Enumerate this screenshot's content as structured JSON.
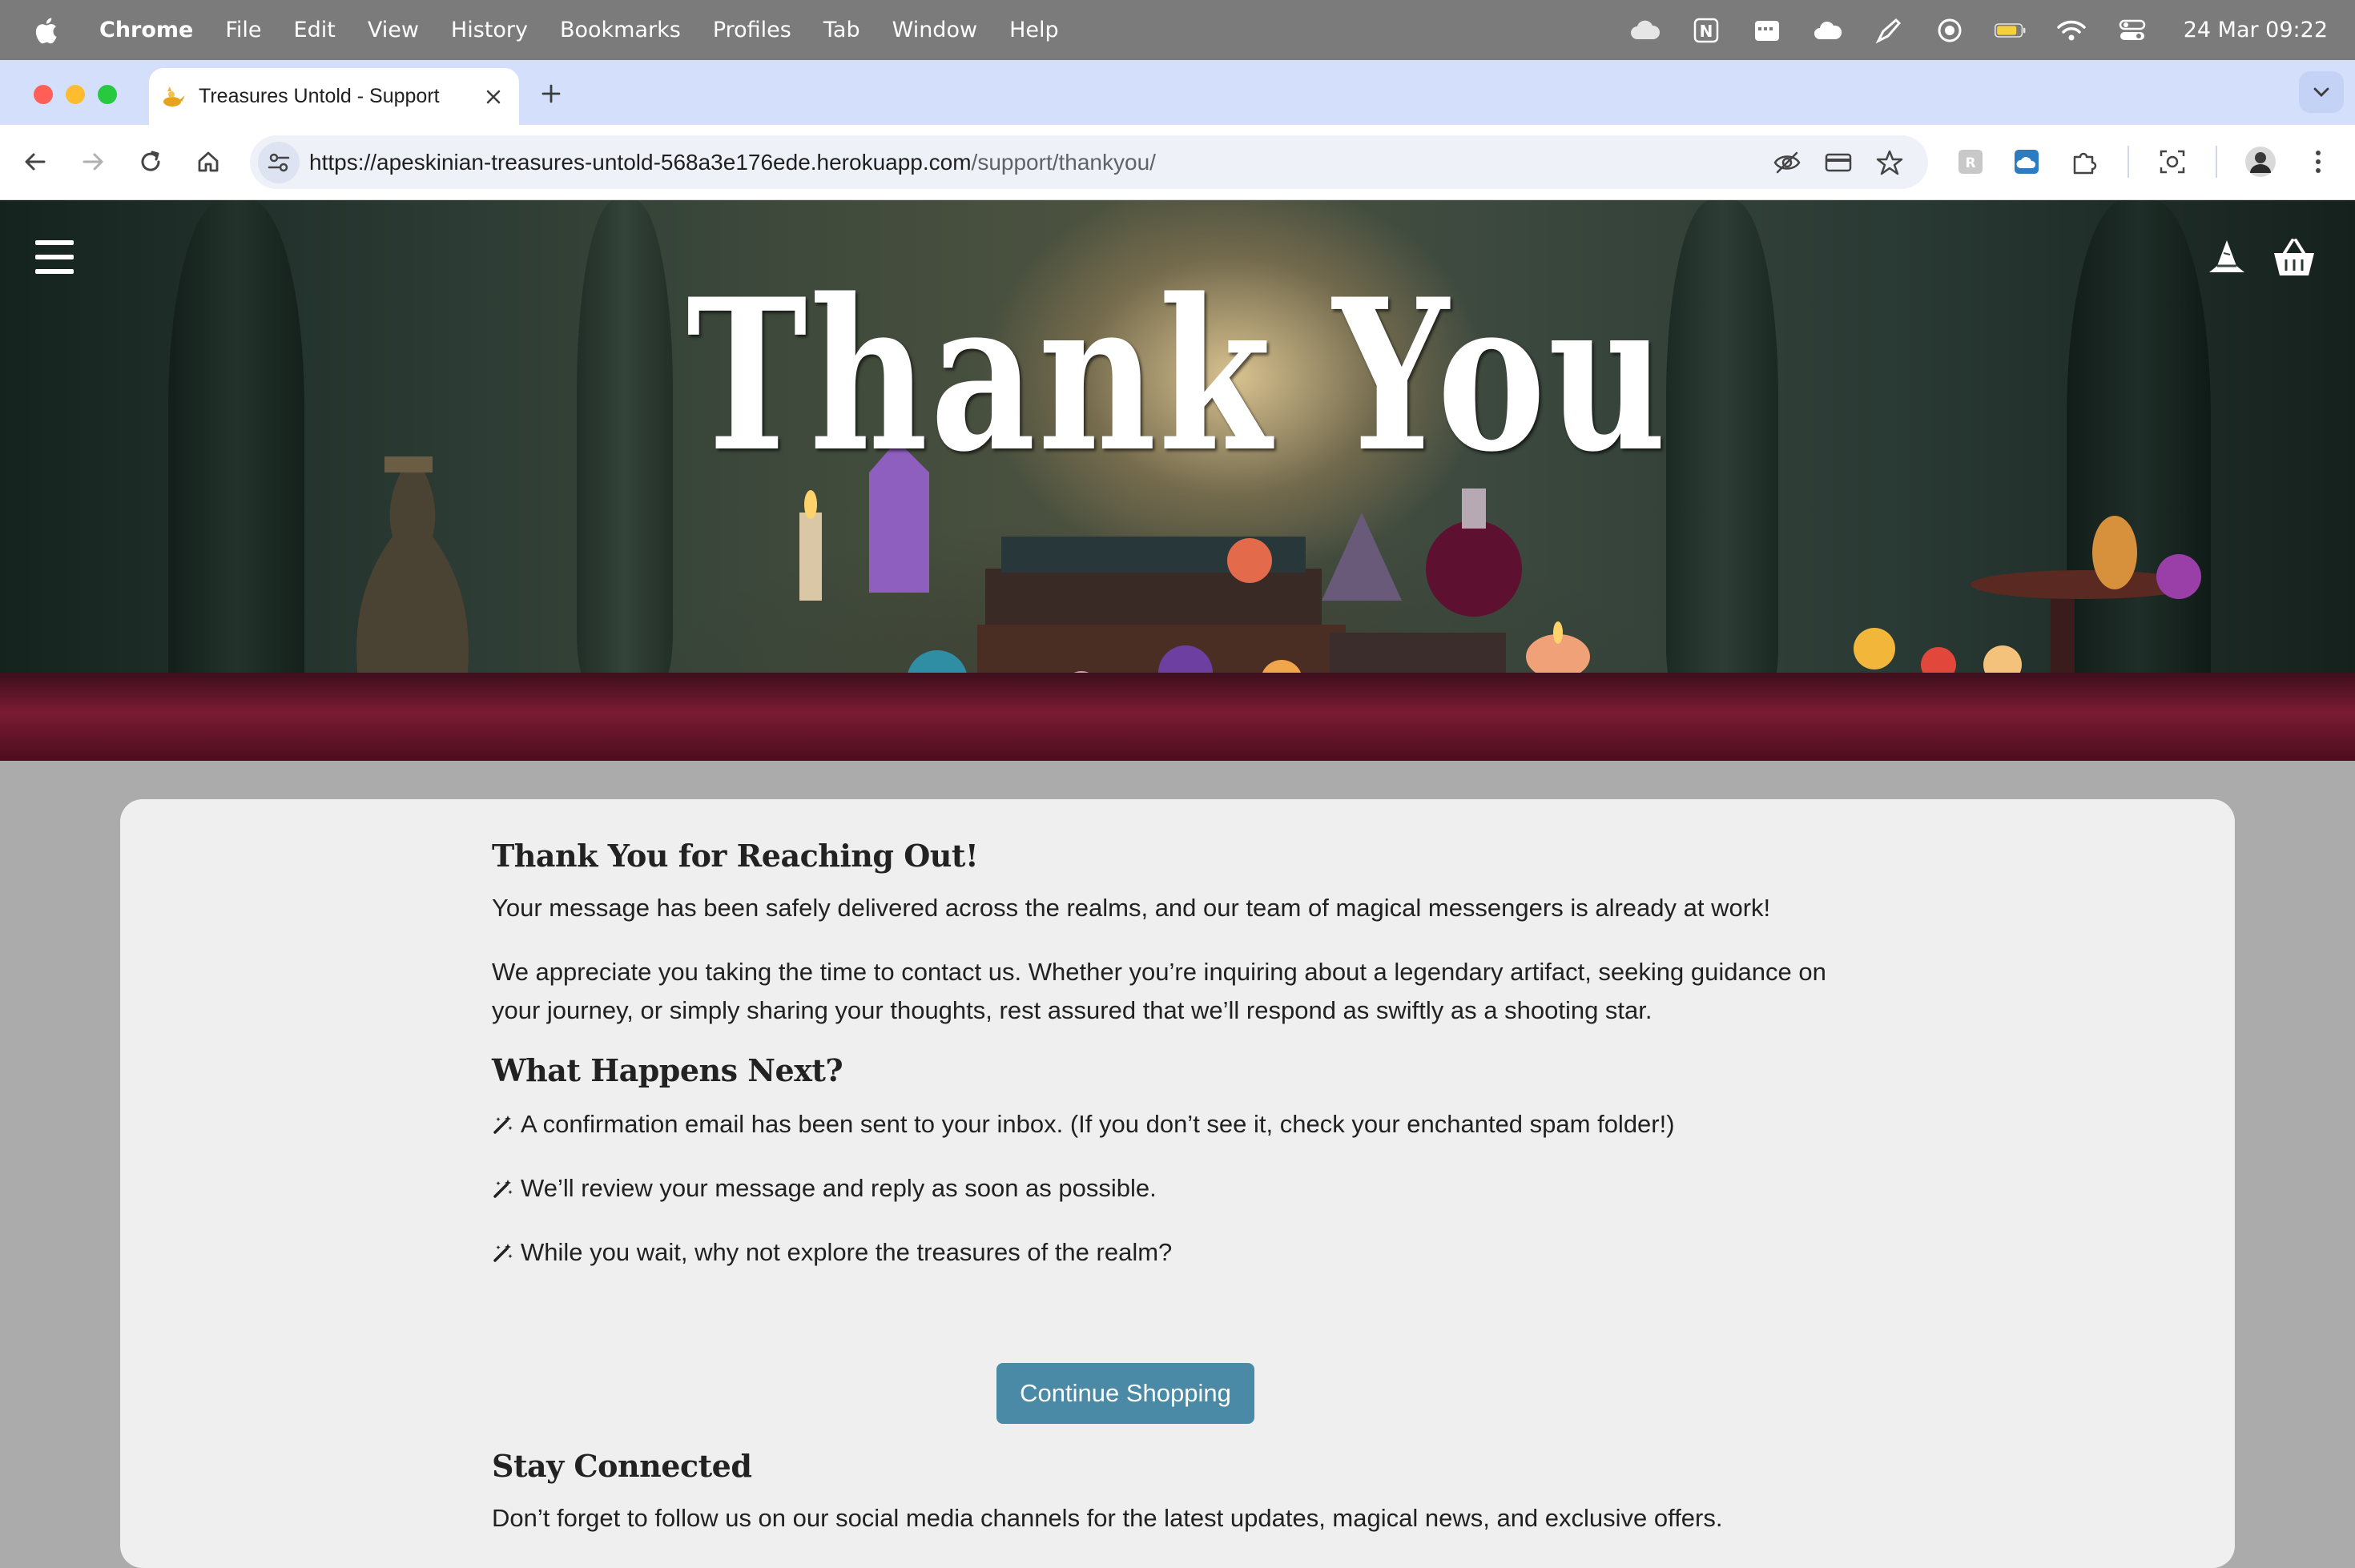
{
  "menubar": {
    "app_name": "Chrome",
    "items": [
      "File",
      "Edit",
      "View",
      "History",
      "Bookmarks",
      "Profiles",
      "Tab",
      "Window",
      "Help"
    ],
    "clock": "24 Mar  09:22",
    "status_icons": [
      "creative-cloud-icon",
      "notion-icon",
      "calendar-icon",
      "cloud-icon",
      "pencil-tool-icon",
      "circle-record-icon",
      "battery-icon",
      "wifi-icon",
      "control-center-icon"
    ]
  },
  "browser": {
    "tab_title": "Treasures Untold - Support",
    "url_host": "https://apeskinian-treasures-untold-568a3e176ede.herokuapp.com",
    "url_path": "/support/thankyou/"
  },
  "hero": {
    "title": "Thank You"
  },
  "main": {
    "heading_thanks": "Thank You for Reaching Out!",
    "para_delivered": "Your message has been safely delivered across the realms, and our team of magical messengers is already at work!",
    "para_appreciate": "We appreciate you taking the time to contact us. Whether you’re inquiring about a legendary artifact, seeking guidance on your journey, or simply sharing your thoughts, rest assured that we’ll respond as swiftly as a shooting star.",
    "heading_next": "What Happens Next?",
    "steps": [
      "A confirmation email has been sent to your inbox. (If you don’t see it, check your enchanted spam folder!)",
      "We’ll review your message and reply as soon as possible.",
      "While you wait, why not explore the treasures of the realm?"
    ],
    "cta_label": "Continue Shopping",
    "heading_stay": "Stay Connected",
    "para_follow": "Don’t forget to follow us on our social media channels for the latest updates, magical news, and exclusive offers."
  },
  "colors": {
    "accent_button": "#4a8aa6",
    "card_bg": "#efefef",
    "tabstrip_bg": "#d4e0fb"
  }
}
